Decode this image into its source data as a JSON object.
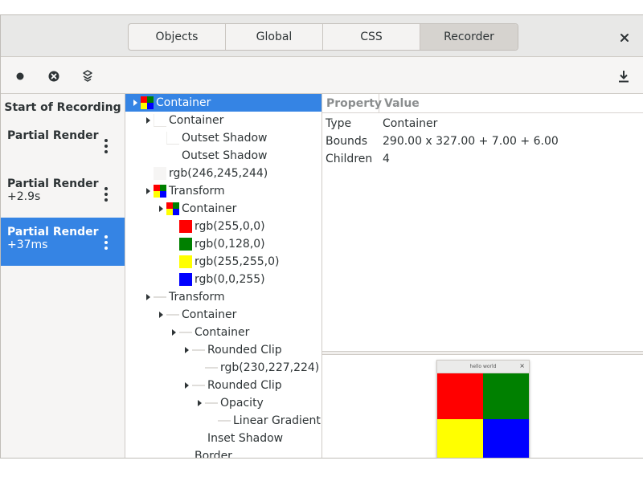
{
  "header": {
    "tabs": [
      {
        "label": "Objects",
        "active": false
      },
      {
        "label": "Global",
        "active": false
      },
      {
        "label": "CSS",
        "active": false
      },
      {
        "label": "Recorder",
        "active": true
      }
    ],
    "close_icon": "close-icon"
  },
  "toolbar": {
    "record_icon": "record-icon",
    "clear_icon": "clear-icon",
    "render_node_icon": "layers-icon",
    "save_icon": "download-icon"
  },
  "sidebar": {
    "title": "Start of Recording",
    "items": [
      {
        "name": "Partial Render",
        "time": "",
        "active": false
      },
      {
        "name": "Partial Render",
        "time": "+2.9s",
        "active": false
      },
      {
        "name": "Partial Render",
        "time": "+37ms",
        "active": true
      }
    ]
  },
  "tree": {
    "rows": [
      {
        "label": "Container",
        "level": 0,
        "expander": true,
        "thumb": "grid4",
        "selected": true
      },
      {
        "label": "Container",
        "level": 1,
        "expander": true,
        "thumb": "blank"
      },
      {
        "label": "Outset Shadow",
        "level": 2,
        "expander": false,
        "thumb": "blank"
      },
      {
        "label": "Outset Shadow",
        "level": 2,
        "expander": false,
        "thumb": "none"
      },
      {
        "label": "rgb(246,245,244)",
        "level": 1,
        "expander": false,
        "thumb": "bgcolor"
      },
      {
        "label": "Transform",
        "level": 1,
        "expander": true,
        "thumb": "grid4"
      },
      {
        "label": "Container",
        "level": 2,
        "expander": true,
        "thumb": "grid4"
      },
      {
        "label": "rgb(255,0,0)",
        "level": 3,
        "expander": false,
        "thumb": "color",
        "color": "#ff0000"
      },
      {
        "label": "rgb(0,128,0)",
        "level": 3,
        "expander": false,
        "thumb": "color",
        "color": "#008000"
      },
      {
        "label": "rgb(255,255,0)",
        "level": 3,
        "expander": false,
        "thumb": "color",
        "color": "#ffff00"
      },
      {
        "label": "rgb(0,0,255)",
        "level": 3,
        "expander": false,
        "thumb": "color",
        "color": "#0000ff"
      },
      {
        "label": "Transform",
        "level": 1,
        "expander": true,
        "thumb": "line"
      },
      {
        "label": "Container",
        "level": 2,
        "expander": true,
        "thumb": "line"
      },
      {
        "label": "Container",
        "level": 3,
        "expander": true,
        "thumb": "line"
      },
      {
        "label": "Rounded Clip",
        "level": 4,
        "expander": true,
        "thumb": "line"
      },
      {
        "label": "rgb(230,227,224)",
        "level": 5,
        "expander": false,
        "thumb": "line"
      },
      {
        "label": "Rounded Clip",
        "level": 4,
        "expander": true,
        "thumb": "line"
      },
      {
        "label": "Opacity",
        "level": 5,
        "expander": true,
        "thumb": "line"
      },
      {
        "label": "Linear Gradient",
        "level": 6,
        "expander": false,
        "thumb": "line"
      },
      {
        "label": "Inset Shadow",
        "level": 4,
        "expander": false,
        "thumb": "none"
      },
      {
        "label": "Border",
        "level": 3,
        "expander": false,
        "thumb": "none"
      }
    ]
  },
  "properties": {
    "headers": {
      "property": "Property",
      "value": "Value"
    },
    "rows": [
      {
        "key": "Type",
        "value": "Container"
      },
      {
        "key": "Bounds",
        "value": "290.00 x 327.00 + 7.00 + 6.00"
      },
      {
        "key": "Children",
        "value": "4"
      }
    ]
  },
  "preview": {
    "title": "hello world",
    "close": "×",
    "colors": [
      "#ff0000",
      "#008000",
      "#ffff00",
      "#0000ff"
    ]
  },
  "colors": {
    "accent": "#3584e4",
    "grid4": [
      "#ff0000",
      "#008000",
      "#ffff00",
      "#0000ff"
    ],
    "bgcolor": "#f6f5f4"
  }
}
